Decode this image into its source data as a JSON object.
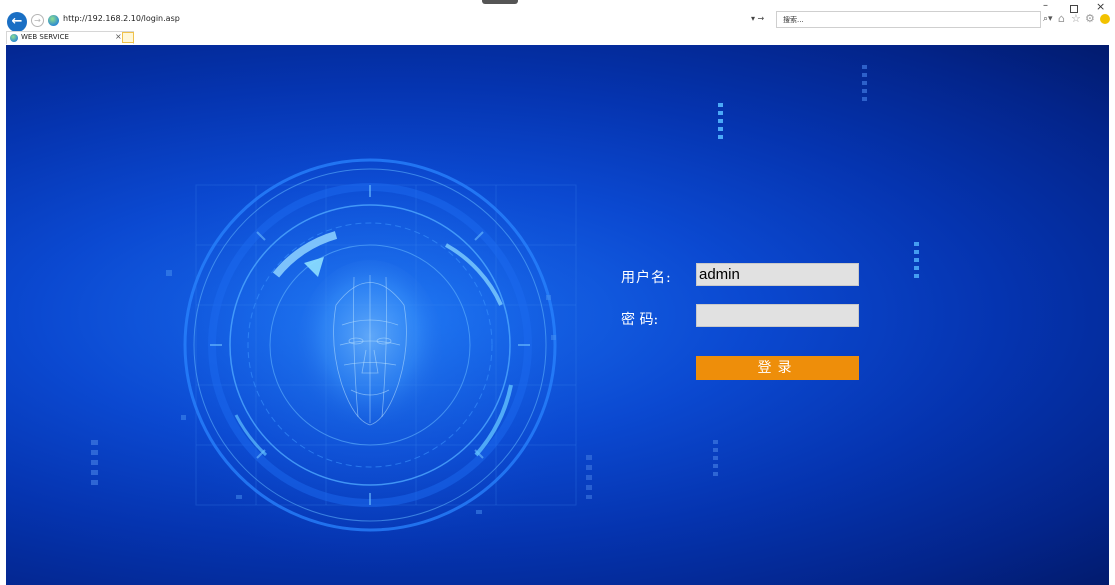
{
  "browser": {
    "url": "http://192.168.2.10/login.asp",
    "nav_arrows": "▾ →",
    "search_placeholder": "搜索...",
    "tab_title": "WEB SERVICE",
    "tab_close": "×",
    "window_min": "–",
    "window_close": "×"
  },
  "login": {
    "username_label": "用户名:",
    "password_label": "密  码:",
    "username_value": "admin",
    "password_value": "",
    "submit_label": "登录"
  },
  "colors": {
    "accent_button": "#ee8e0a",
    "background_blue": "#0b49d1"
  },
  "icons": [
    "back-arrow-icon",
    "forward-arrow-icon",
    "site-icon",
    "search-icon",
    "home-icon",
    "star-icon",
    "gear-icon",
    "smile-icon",
    "new-tab-icon",
    "face-scan-illustration"
  ]
}
